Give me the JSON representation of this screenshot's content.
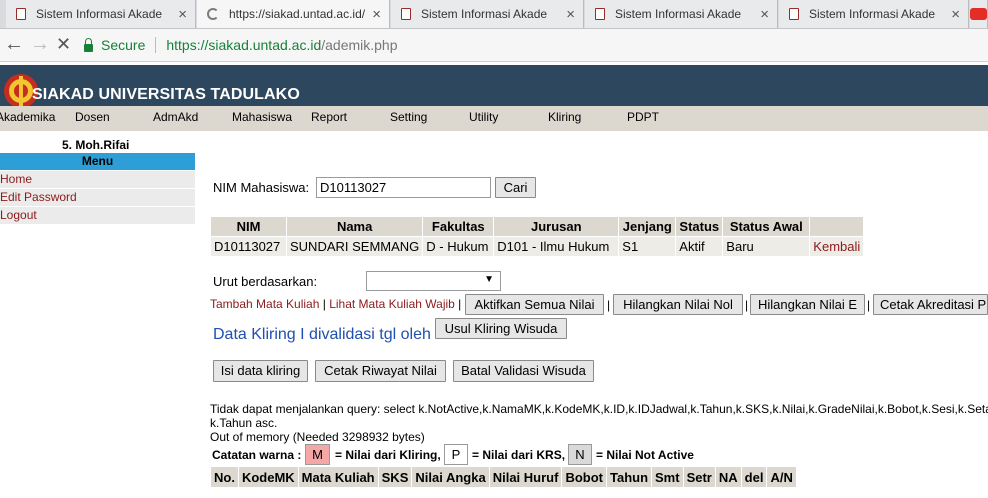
{
  "browser": {
    "tabs": [
      {
        "title": "Sistem Informasi Akade",
        "active": false
      },
      {
        "title": "https://siakad.untad.ac.id/",
        "active": true
      },
      {
        "title": "Sistem Informasi Akade",
        "active": false
      },
      {
        "title": "Sistem Informasi Akade",
        "active": false
      },
      {
        "title": "Sistem Informasi Akade",
        "active": false
      }
    ],
    "secure_label": "Secure",
    "url_host": "https://siakad.untad.ac.id",
    "url_path": "/ademik.php"
  },
  "site": {
    "title": "SIAKAD UNIVERSITAS TADULAKO",
    "menu": [
      "Akademika",
      "Dosen",
      "AdmAkd",
      "Mahasiswa",
      "Report",
      "Setting",
      "Utility",
      "Kliring",
      "PDPT"
    ]
  },
  "sidebar": {
    "user": "5. Moh.Rifai",
    "menu_title": "Menu",
    "items": [
      "Home",
      "Edit Password",
      "Logout"
    ]
  },
  "search": {
    "label": "NIM Mahasiswa:",
    "value": "D10113027",
    "button": "Cari"
  },
  "student_table": {
    "headers": [
      "NIM",
      "Nama",
      "Fakultas",
      "Jurusan",
      "Jenjang",
      "Status",
      "Status Awal",
      ""
    ],
    "row": [
      "D10113027",
      "SUNDARI SEMMANG",
      "D - Hukum",
      "D101 - Ilmu Hukum",
      "S1",
      "Aktif",
      "Baru",
      "Kembali"
    ]
  },
  "sort": {
    "label": "Urut berdasarkan:",
    "selected": ""
  },
  "actions": {
    "link_tambah": "Tambah Mata Kuliah",
    "link_lihat": "Lihat Mata Kuliah Wajib",
    "btn_aktifkan": "Aktifkan Semua Nilai",
    "btn_nol": "Hilangkan Nilai Nol",
    "btn_e": "Hilangkan Nilai E",
    "btn_cetak_akreditasi": "Cetak Akreditasi P"
  },
  "kliring": {
    "text": "Data Kliring I divalidasi tgl oleh",
    "btn_usul": "Usul Kliring Wisuda",
    "btn_isi": "Isi data kliring",
    "btn_riwayat": "Cetak Riwayat Nilai",
    "btn_batal": "Batal Validasi Wisuda"
  },
  "error": {
    "line1": "Tidak dapat menjalankan query: select k.NotActive,k.NamaMK,k.KodeMK,k.ID,k.IDJadwal,k.Tahun,k.SKS,k.Nilai,k.GradeNilai,k.Bobot,k.Sesi,k.Seta",
    "line2": "k.Tahun asc.",
    "line3": "Out of memory (Needed 3298932 bytes)"
  },
  "legend": {
    "title": "Catatan warna :",
    "m_label": "M",
    "m_text": "= Nilai dari Kliring,",
    "p_label": "P",
    "p_text": "= Nilai dari KRS,",
    "n_label": "N",
    "n_text": "= Nilai Not Active",
    "m_color": "#f4a7a7",
    "p_color": "#ffffff",
    "n_color": "#d9d9d9"
  },
  "nilai_table": {
    "headers": [
      "No.",
      "KodeMK",
      "Mata Kuliah",
      "SKS",
      "Nilai Angka",
      "Nilai Huruf",
      "Bobot",
      "Tahun",
      "Smt",
      "Setr",
      "NA",
      "del",
      "A/N"
    ]
  }
}
